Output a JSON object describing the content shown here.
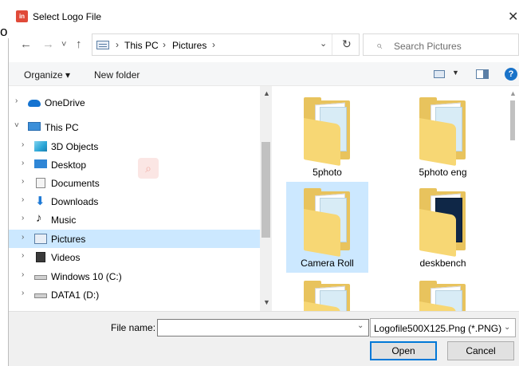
{
  "window": {
    "app_icon_text": "in",
    "title": "Select Logo File",
    "close_glyph": "✕",
    "edge_glyph": "o"
  },
  "address": {
    "back_glyph": "←",
    "forward_glyph": "→",
    "recent_glyph": "˅",
    "up_glyph": "↑",
    "crumbs": [
      "This PC",
      "Pictures"
    ],
    "separator": "›",
    "dropdown_glyph": "⌄",
    "refresh_glyph": "↻"
  },
  "search": {
    "placeholder": "Search Pictures",
    "icon_glyph": "⌕"
  },
  "toolbar": {
    "organize_label": "Organize ▾",
    "new_folder_label": "New folder",
    "view_dropdown": "▼",
    "help": "?"
  },
  "nav_pane": {
    "items": [
      {
        "label": "OneDrive",
        "chevron": "›",
        "icon": "cloud-icon"
      },
      {
        "label": "This PC",
        "chevron": "˅",
        "icon": "computer-icon"
      },
      {
        "label": "3D Objects",
        "chevron": "›",
        "icon": "cube-icon"
      },
      {
        "label": "Desktop",
        "chevron": "›",
        "icon": "desktop-icon"
      },
      {
        "label": "Documents",
        "chevron": "›",
        "icon": "document-icon"
      },
      {
        "label": "Downloads",
        "chevron": "›",
        "icon": "download-icon"
      },
      {
        "label": "Music",
        "chevron": "›",
        "icon": "music-icon"
      },
      {
        "label": "Pictures",
        "chevron": "›",
        "icon": "pictures-icon",
        "selected": true
      },
      {
        "label": "Videos",
        "chevron": "›",
        "icon": "video-icon"
      },
      {
        "label": "Windows 10 (C:)",
        "chevron": "›",
        "icon": "drive-icon"
      },
      {
        "label": "DATA1 (D:)",
        "chevron": "›",
        "icon": "drive-icon"
      }
    ],
    "scroll_up": "▲",
    "scroll_down": "▼",
    "music_glyph": "♪",
    "download_glyph": "⬇"
  },
  "files": {
    "items": [
      {
        "label": "5photo",
        "selected": false,
        "dark": false
      },
      {
        "label": "5photo eng",
        "selected": false,
        "dark": false
      },
      {
        "label": "Camera Roll",
        "selected": true,
        "dark": false
      },
      {
        "label": "deskbench",
        "selected": false,
        "dark": true
      },
      {
        "label": "",
        "selected": false,
        "dark": false
      },
      {
        "label": "",
        "selected": false,
        "dark": false
      }
    ],
    "scroll_up": "▲"
  },
  "bottom": {
    "file_name_label": "File name:",
    "file_name_value": "",
    "file_name_drop": "⌄",
    "file_type_value": "Logofile500X125.Png (*.PNG)",
    "file_type_drop": "⌄",
    "open_label": "Open",
    "cancel_label": "Cancel"
  }
}
